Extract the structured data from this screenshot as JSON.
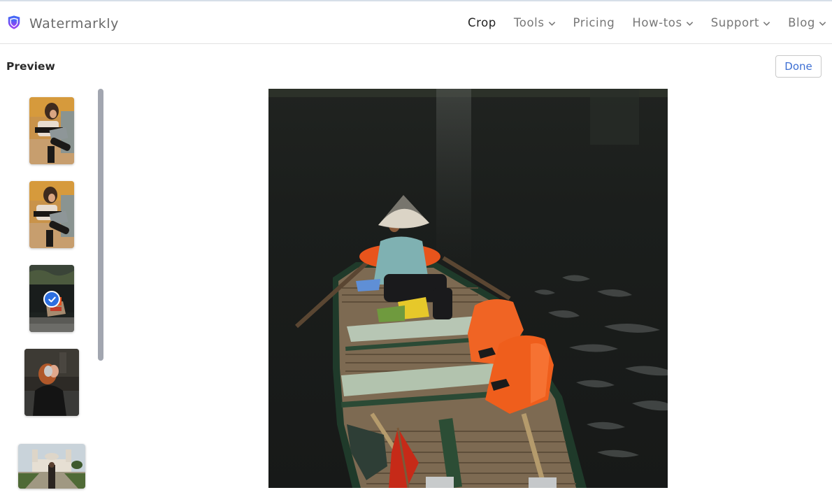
{
  "app": {
    "name": "Watermarkly",
    "logo_icon": "shield-icon",
    "brand_colors": {
      "logo_gradient_start": "#3b6cf6",
      "logo_gradient_end": "#a13cf2"
    }
  },
  "nav": {
    "items": [
      {
        "label": "Crop",
        "active": true,
        "has_dropdown": false
      },
      {
        "label": "Tools",
        "active": false,
        "has_dropdown": true
      },
      {
        "label": "Pricing",
        "active": false,
        "has_dropdown": false
      },
      {
        "label": "How-tos",
        "active": false,
        "has_dropdown": true
      },
      {
        "label": "Support",
        "active": false,
        "has_dropdown": true
      },
      {
        "label": "Blog",
        "active": false,
        "has_dropdown": true
      }
    ]
  },
  "preview": {
    "title": "Preview",
    "done_label": "Done",
    "thumbnails": [
      {
        "subject": "woman with laptop sitting on floor",
        "selected": false
      },
      {
        "subject": "woman with laptop sitting on floor",
        "selected": false
      },
      {
        "subject": "boat on dark lake",
        "selected": true
      },
      {
        "subject": "woman with headphones",
        "selected": false
      },
      {
        "subject": "woman in front of white palace",
        "selected": false
      }
    ],
    "selected_icon": "check-circle-icon"
  },
  "main_image": {
    "subject": "person in conical hat on wooden rowboat with orange life vests on dark water"
  }
}
